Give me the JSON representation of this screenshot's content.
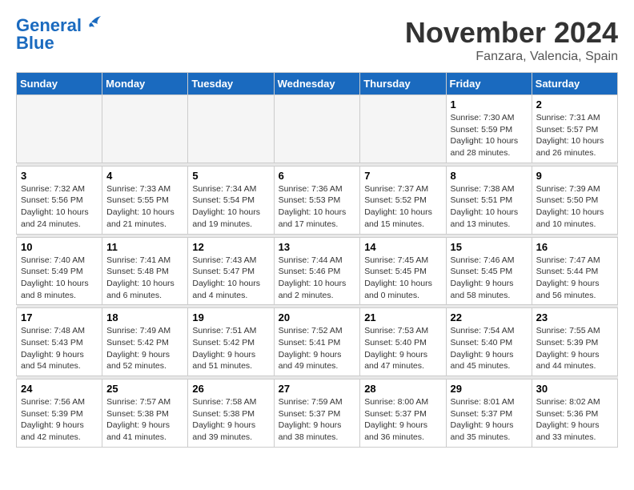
{
  "logo": {
    "line1": "General",
    "line2": "Blue"
  },
  "title": "November 2024",
  "location": "Fanzara, Valencia, Spain",
  "days_header": [
    "Sunday",
    "Monday",
    "Tuesday",
    "Wednesday",
    "Thursday",
    "Friday",
    "Saturday"
  ],
  "weeks": [
    [
      {
        "day": "",
        "info": ""
      },
      {
        "day": "",
        "info": ""
      },
      {
        "day": "",
        "info": ""
      },
      {
        "day": "",
        "info": ""
      },
      {
        "day": "",
        "info": ""
      },
      {
        "day": "1",
        "info": "Sunrise: 7:30 AM\nSunset: 5:59 PM\nDaylight: 10 hours and 28 minutes."
      },
      {
        "day": "2",
        "info": "Sunrise: 7:31 AM\nSunset: 5:57 PM\nDaylight: 10 hours and 26 minutes."
      }
    ],
    [
      {
        "day": "3",
        "info": "Sunrise: 7:32 AM\nSunset: 5:56 PM\nDaylight: 10 hours and 24 minutes."
      },
      {
        "day": "4",
        "info": "Sunrise: 7:33 AM\nSunset: 5:55 PM\nDaylight: 10 hours and 21 minutes."
      },
      {
        "day": "5",
        "info": "Sunrise: 7:34 AM\nSunset: 5:54 PM\nDaylight: 10 hours and 19 minutes."
      },
      {
        "day": "6",
        "info": "Sunrise: 7:36 AM\nSunset: 5:53 PM\nDaylight: 10 hours and 17 minutes."
      },
      {
        "day": "7",
        "info": "Sunrise: 7:37 AM\nSunset: 5:52 PM\nDaylight: 10 hours and 15 minutes."
      },
      {
        "day": "8",
        "info": "Sunrise: 7:38 AM\nSunset: 5:51 PM\nDaylight: 10 hours and 13 minutes."
      },
      {
        "day": "9",
        "info": "Sunrise: 7:39 AM\nSunset: 5:50 PM\nDaylight: 10 hours and 10 minutes."
      }
    ],
    [
      {
        "day": "10",
        "info": "Sunrise: 7:40 AM\nSunset: 5:49 PM\nDaylight: 10 hours and 8 minutes."
      },
      {
        "day": "11",
        "info": "Sunrise: 7:41 AM\nSunset: 5:48 PM\nDaylight: 10 hours and 6 minutes."
      },
      {
        "day": "12",
        "info": "Sunrise: 7:43 AM\nSunset: 5:47 PM\nDaylight: 10 hours and 4 minutes."
      },
      {
        "day": "13",
        "info": "Sunrise: 7:44 AM\nSunset: 5:46 PM\nDaylight: 10 hours and 2 minutes."
      },
      {
        "day": "14",
        "info": "Sunrise: 7:45 AM\nSunset: 5:45 PM\nDaylight: 10 hours and 0 minutes."
      },
      {
        "day": "15",
        "info": "Sunrise: 7:46 AM\nSunset: 5:45 PM\nDaylight: 9 hours and 58 minutes."
      },
      {
        "day": "16",
        "info": "Sunrise: 7:47 AM\nSunset: 5:44 PM\nDaylight: 9 hours and 56 minutes."
      }
    ],
    [
      {
        "day": "17",
        "info": "Sunrise: 7:48 AM\nSunset: 5:43 PM\nDaylight: 9 hours and 54 minutes."
      },
      {
        "day": "18",
        "info": "Sunrise: 7:49 AM\nSunset: 5:42 PM\nDaylight: 9 hours and 52 minutes."
      },
      {
        "day": "19",
        "info": "Sunrise: 7:51 AM\nSunset: 5:42 PM\nDaylight: 9 hours and 51 minutes."
      },
      {
        "day": "20",
        "info": "Sunrise: 7:52 AM\nSunset: 5:41 PM\nDaylight: 9 hours and 49 minutes."
      },
      {
        "day": "21",
        "info": "Sunrise: 7:53 AM\nSunset: 5:40 PM\nDaylight: 9 hours and 47 minutes."
      },
      {
        "day": "22",
        "info": "Sunrise: 7:54 AM\nSunset: 5:40 PM\nDaylight: 9 hours and 45 minutes."
      },
      {
        "day": "23",
        "info": "Sunrise: 7:55 AM\nSunset: 5:39 PM\nDaylight: 9 hours and 44 minutes."
      }
    ],
    [
      {
        "day": "24",
        "info": "Sunrise: 7:56 AM\nSunset: 5:39 PM\nDaylight: 9 hours and 42 minutes."
      },
      {
        "day": "25",
        "info": "Sunrise: 7:57 AM\nSunset: 5:38 PM\nDaylight: 9 hours and 41 minutes."
      },
      {
        "day": "26",
        "info": "Sunrise: 7:58 AM\nSunset: 5:38 PM\nDaylight: 9 hours and 39 minutes."
      },
      {
        "day": "27",
        "info": "Sunrise: 7:59 AM\nSunset: 5:37 PM\nDaylight: 9 hours and 38 minutes."
      },
      {
        "day": "28",
        "info": "Sunrise: 8:00 AM\nSunset: 5:37 PM\nDaylight: 9 hours and 36 minutes."
      },
      {
        "day": "29",
        "info": "Sunrise: 8:01 AM\nSunset: 5:37 PM\nDaylight: 9 hours and 35 minutes."
      },
      {
        "day": "30",
        "info": "Sunrise: 8:02 AM\nSunset: 5:36 PM\nDaylight: 9 hours and 33 minutes."
      }
    ]
  ]
}
